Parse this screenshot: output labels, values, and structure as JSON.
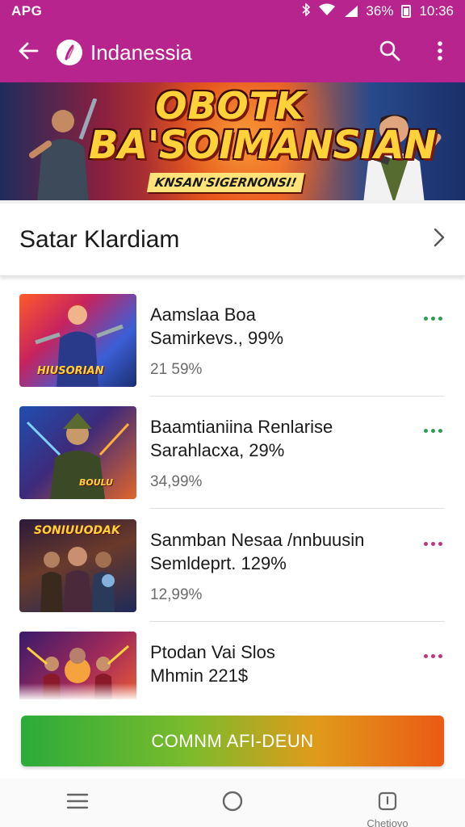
{
  "status_bar": {
    "carrier": "APG",
    "battery": "36%",
    "time": "10:36"
  },
  "app_bar": {
    "title": "Indanessia"
  },
  "banner": {
    "headline_1": "OBOTK",
    "headline_2": "BA'SOIMANSIAN",
    "tagline": "KNSAN'SIGERNONSI!"
  },
  "section": {
    "title": "Satar Klardiam"
  },
  "items": [
    {
      "title": "Aamslaa Boa",
      "subtitle": "Samirkevs., 99%",
      "meta": "21 59%",
      "dot_color": "#2e9e52"
    },
    {
      "title": "Baamtianiina Renlarise",
      "subtitle": "Sarahlacxa, 29%",
      "meta": "34,99%",
      "dot_color": "#2e9e52"
    },
    {
      "title": "Sanmban Nesaa /nnbuusin",
      "subtitle": "Semldeprt. 129%",
      "meta": "12,99%",
      "dot_color": "#c2357e"
    },
    {
      "title": "Ptodan Vai Slos",
      "subtitle": "Mhmin 221$",
      "meta": "",
      "dot_color": "#c2357e"
    }
  ],
  "thumb_labels": [
    "HIUSORIAN",
    "BOULU",
    "SONIUUODAK",
    ""
  ],
  "cta": {
    "label": "COMNM AFI-DEUN"
  },
  "nav": {
    "right_label": "Chetioyo"
  },
  "colors": {
    "brand": "#b8248e",
    "cta_start": "#2bab3a",
    "cta_end": "#ea5a14"
  },
  "icons": [
    "back-arrow-icon",
    "app-logo-icon",
    "search-icon",
    "more-vert-icon",
    "chevron-right-icon",
    "menu-icon",
    "home-circle-icon",
    "recent-apps-icon"
  ]
}
